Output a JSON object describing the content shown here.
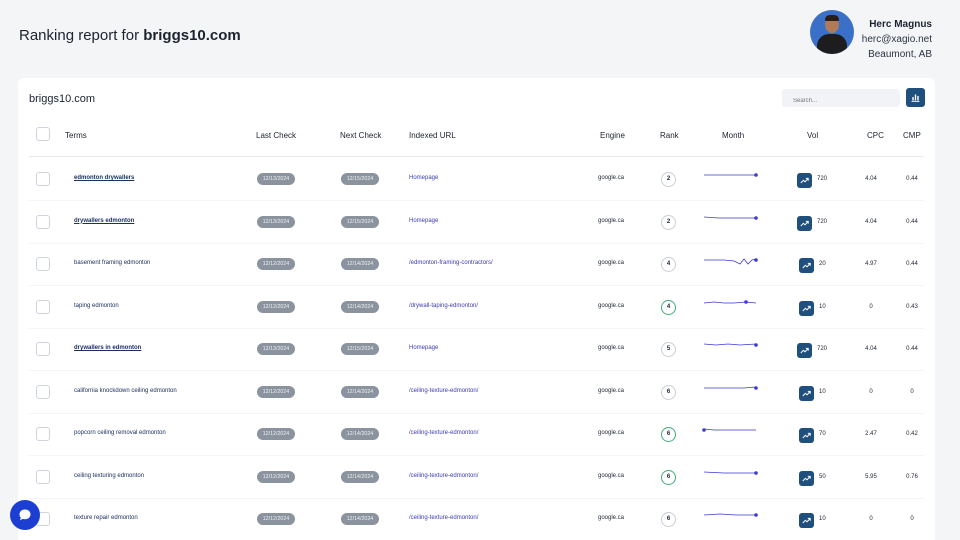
{
  "header": {
    "title_prefix": "Ranking report for",
    "domain": "briggs10.com"
  },
  "user": {
    "name": "Herc Magnus",
    "email": "herc@xagio.net",
    "location": "Beaumont, AB"
  },
  "card": {
    "title": "briggs10.com",
    "search_placeholder": "Search..."
  },
  "columns": {
    "terms": "Terms",
    "last_check": "Last Check",
    "next_check": "Next Check",
    "indexed_url": "Indexed URL",
    "engine": "Engine",
    "rank": "Rank",
    "month": "Month",
    "vol": "Vol",
    "cpc": "CPC",
    "cmp": "CMP"
  },
  "rows": [
    {
      "term": "edmonton drywallers",
      "linked": true,
      "last": "12/13/2024",
      "next": "12/15/2024",
      "url": "Homepage",
      "engine": "google.ca",
      "rank": "2",
      "rank_change": false,
      "vol": "720",
      "cpc": "4.04",
      "cmp": "0.44"
    },
    {
      "term": "drywallers edmonton",
      "linked": true,
      "last": "12/13/2024",
      "next": "12/15/2024",
      "url": "Homepage",
      "engine": "google.ca",
      "rank": "2",
      "rank_change": false,
      "vol": "720",
      "cpc": "4.04",
      "cmp": "0.44"
    },
    {
      "term": "basement framing edmonton",
      "linked": false,
      "last": "12/12/2024",
      "next": "12/14/2024",
      "url": "/edmonton-framing-contractors/",
      "engine": "google.ca",
      "rank": "4",
      "rank_change": false,
      "vol": "20",
      "cpc": "4.97",
      "cmp": "0.44"
    },
    {
      "term": "taping edmonton",
      "linked": false,
      "last": "12/12/2024",
      "next": "12/14/2024",
      "url": "/drywall-taping-edmonton/",
      "engine": "google.ca",
      "rank": "4",
      "rank_change": true,
      "vol": "10",
      "cpc": "0",
      "cmp": "0.43"
    },
    {
      "term": "drywallers in edmonton",
      "linked": true,
      "last": "12/13/2024",
      "next": "12/15/2024",
      "url": "Homepage",
      "engine": "google.ca",
      "rank": "5",
      "rank_change": false,
      "vol": "720",
      "cpc": "4.04",
      "cmp": "0.44"
    },
    {
      "term": "california knockdown ceiling edmonton",
      "linked": false,
      "last": "12/12/2024",
      "next": "12/14/2024",
      "url": "/ceiling-texture-edmonton/",
      "engine": "google.ca",
      "rank": "6",
      "rank_change": false,
      "vol": "10",
      "cpc": "0",
      "cmp": "0"
    },
    {
      "term": "popcorn ceiling removal edmonton",
      "linked": false,
      "last": "12/12/2024",
      "next": "12/14/2024",
      "url": "/ceiling-texture-edmonton/",
      "engine": "google.ca",
      "rank": "6",
      "rank_change": true,
      "vol": "70",
      "cpc": "2.47",
      "cmp": "0.42"
    },
    {
      "term": "ceiling texturing edmonton",
      "linked": false,
      "last": "12/12/2024",
      "next": "12/14/2024",
      "url": "/ceiling-texture-edmonton/",
      "engine": "google.ca",
      "rank": "6",
      "rank_change": true,
      "vol": "50",
      "cpc": "5.95",
      "cmp": "0.76"
    },
    {
      "term": "texture repair edmonton",
      "linked": false,
      "last": "12/12/2024",
      "next": "12/14/2024",
      "url": "/ceiling-texture-edmonton/",
      "engine": "google.ca",
      "rank": "6",
      "rank_change": false,
      "vol": "10",
      "cpc": "0",
      "cmp": "0"
    }
  ],
  "colors": {
    "accent": "#1f4f7c",
    "pill": "#8a939e",
    "link": "#3b3bb5",
    "sparkline": "#3a3ad0",
    "rank_up": "#3fae7a",
    "chat": "#1d3fd1"
  },
  "icons": {
    "chart_button": "bar-chart-icon",
    "trend": "trend-up-icon",
    "chat": "chat-icon"
  }
}
